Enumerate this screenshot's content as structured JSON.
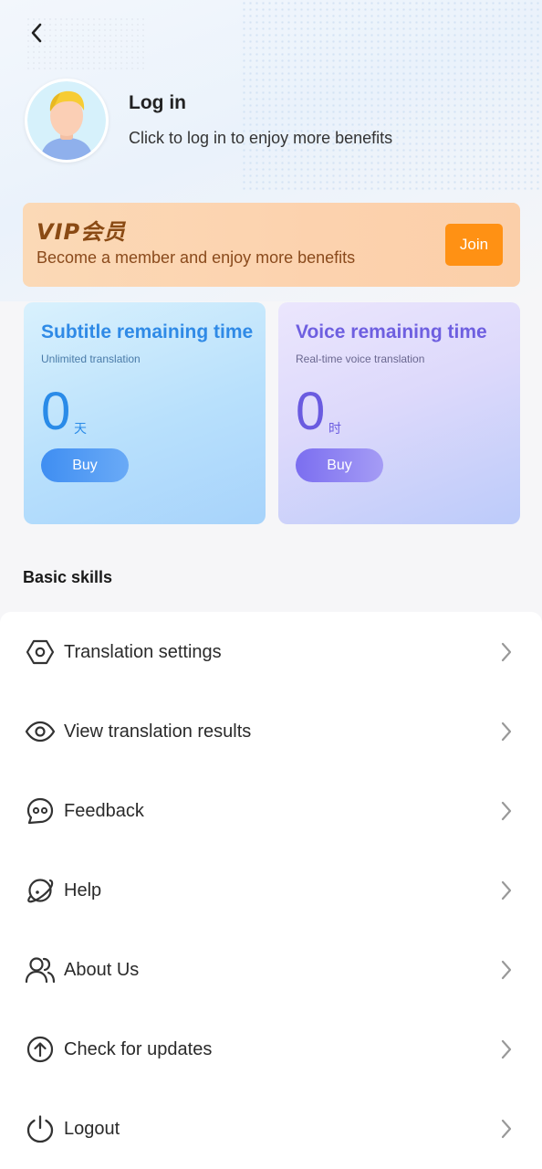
{
  "profile": {
    "title": "Log in",
    "subtitle": "Click to log in to enjoy more benefits"
  },
  "vip": {
    "logo_text": "VIP会员",
    "text": "Become a member and enjoy more benefits",
    "join_label": "Join"
  },
  "cards": {
    "subtitle": {
      "title": "Subtitle remaining time",
      "sub": "Unlimited translation",
      "value": "0",
      "unit": "天",
      "buy_label": "Buy"
    },
    "voice": {
      "title": "Voice remaining time",
      "sub": "Real-time voice translation",
      "value": "0",
      "unit": "时",
      "buy_label": "Buy"
    }
  },
  "section": {
    "title": "Basic skills"
  },
  "menu": {
    "items": [
      {
        "label": "Translation settings",
        "icon": "settings-hexagon-icon"
      },
      {
        "label": "View translation results",
        "icon": "eye-icon"
      },
      {
        "label": "Feedback",
        "icon": "chat-bubble-icon"
      },
      {
        "label": "Help",
        "icon": "planet-icon"
      },
      {
        "label": "About Us",
        "icon": "users-icon"
      },
      {
        "label": "Check for updates",
        "icon": "upload-circle-icon"
      },
      {
        "label": "Logout",
        "icon": "power-icon"
      }
    ]
  },
  "colors": {
    "accent_orange": "#ff9114",
    "subtitle_blue": "#2f8ae6",
    "voice_purple": "#6e5fe0"
  }
}
